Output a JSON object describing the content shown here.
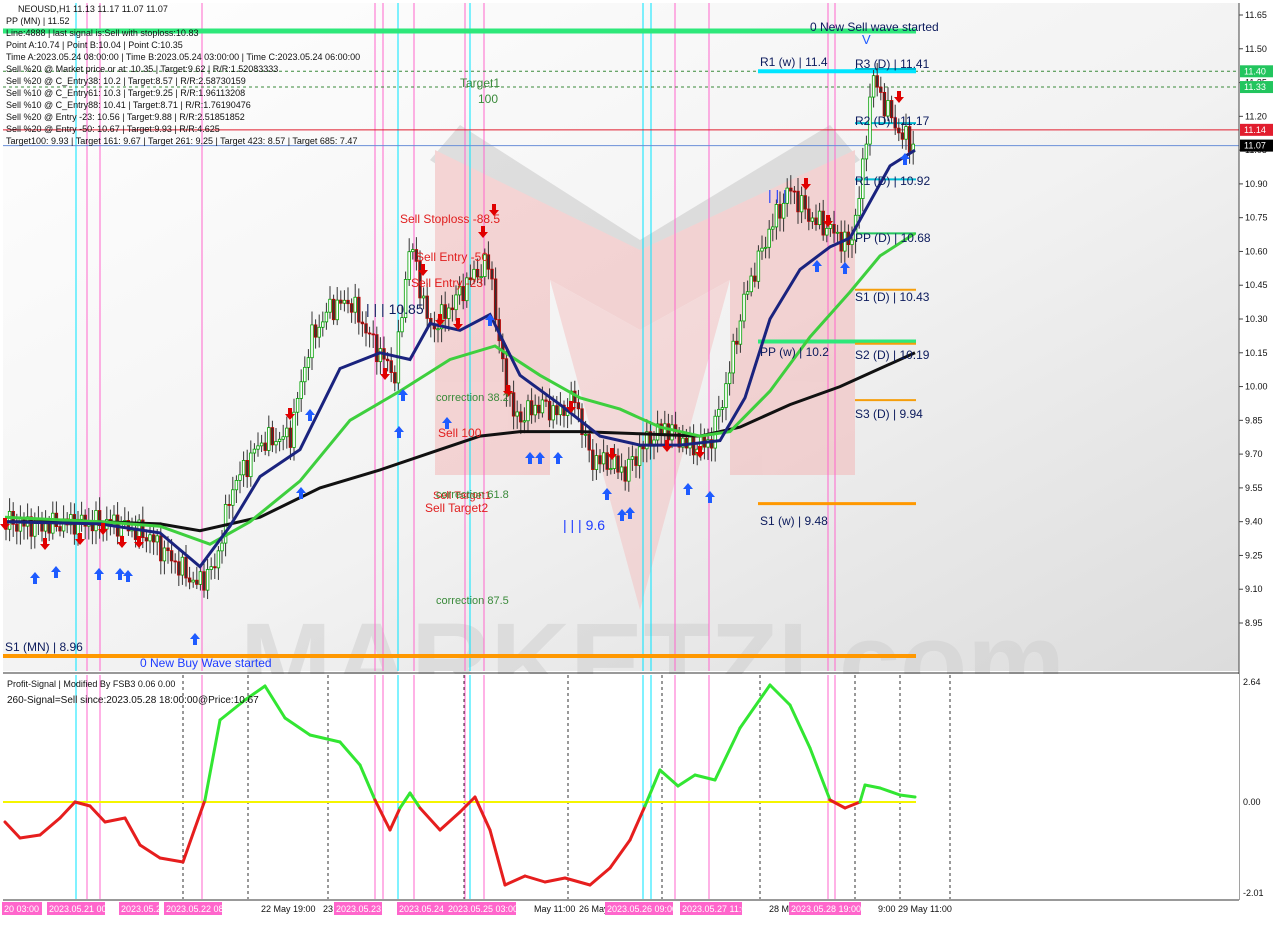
{
  "header": {
    "symbol_line": "NEOUSD,H1  11.13 11.17 11.07 11.07",
    "lines": [
      "PP (MN) | 11.52",
      "Line:4888 | last signal is:Sell with stoploss:10.83",
      "Point A:10.74 | Point B:10.04 | Point C:10.35",
      "Time A:2023.05.24 08:00:00 | Time B:2023.05.24 03:00:00 | Time C:2023.05.24 06:00:00",
      "Sell %20 @ Market price or at: 10.35 | Target:9.62 | R/R:1.52083333",
      "Sell %20 @ C_Entry38: 10.2 | Target:8.57 | R/R:2.58730159",
      "Sell %10 @ C_Entry61: 10.3 | Target:9.25 | R/R:1.96113208",
      "Sell %10 @ C_Entry88: 10.41 | Target:8.71 | R/R:1.76190476",
      "Sell %20 @ Entry -23: 10.56 | Target:9.88 | R/R:2.51851852",
      "Sell %20 @ Entry -50: 10.67 | Target:9.93 | R/R:4.625",
      "Target100: 9.93 | Target 161: 9.67 | Target 261: 9.25 | Target 423: 8.57 | Target 685: 7.47"
    ]
  },
  "price_axis": {
    "ticks": [
      "11.65",
      "11.50",
      "11.35",
      "11.20",
      "11.05",
      "10.90",
      "10.75",
      "10.60",
      "10.45",
      "10.30",
      "10.15",
      "10.00",
      "9.85",
      "9.70",
      "9.55",
      "9.40",
      "9.25",
      "9.10",
      "8.95"
    ],
    "badges": [
      {
        "label": "11.40",
        "color": "#22c55e"
      },
      {
        "label": "11.33",
        "color": "#22c55e"
      },
      {
        "label": "11.14",
        "color": "#e11d2e"
      },
      {
        "label": "11.07",
        "color": "#000000"
      }
    ]
  },
  "levels": [
    {
      "label": "R1 (w) | 11.4",
      "color": "#00bcd4"
    },
    {
      "label": "R3 (D) | 11.41",
      "color": "#00bcd4"
    },
    {
      "label": "R2 (D) | 11.17",
      "color": "#00bcd4"
    },
    {
      "label": "R1 (D) | 10.92",
      "color": "#00bcd4"
    },
    {
      "label": "PP (D) | 10.68",
      "color": "#22c55e"
    },
    {
      "label": "S1 (D) | 10.43",
      "color": "#f59e0b"
    },
    {
      "label": "PP (w) | 10.2",
      "color": "#22c55e"
    },
    {
      "label": "S2 (D) | 10.19",
      "color": "#f59e0b"
    },
    {
      "label": "S3 (D) | 9.94",
      "color": "#f59e0b"
    },
    {
      "label": "S1 (w) | 9.48",
      "color": "#f59e0b"
    },
    {
      "label": "S1 (MN) | 8.96",
      "color": "#f59e0b"
    }
  ],
  "annotations": {
    "sell_wave": "0 New Sell wave started",
    "buy_wave": "0 New Buy Wave started",
    "target1": "Target1",
    "target1_value": "100",
    "sell_stoploss": "Sell Stoploss -88.5",
    "sell_entry_50": "Sell Entry -50",
    "sell_entry_23": "Sell Entry -23",
    "sell_100": "Sell 100",
    "sell_target1": "Sell Target1",
    "sell_target2": "Sell Target2",
    "correction_38": "correction 38.2",
    "correction_61": "correction 61.8",
    "correction_87": "correction 87.5",
    "wave_high": "| | | 10.85",
    "wave_low": "| | | 9.6",
    "wave_mark": "| | |"
  },
  "indicator": {
    "name": "Profit-Signal | Modified By FSB3 0.06 0.00",
    "signal": "260-Signal=Sell since:2023.05.28 18:00:00@Price:10.67",
    "ticks": [
      "2.64",
      "0.00",
      "-2.01"
    ]
  },
  "time_axis": [
    {
      "label": "20 03:00",
      "highlight": true
    },
    {
      "label": "2023.05.21 00:00",
      "highlight": true
    },
    {
      "label": "2023.05.21 13:00",
      "highlight": true
    },
    {
      "label": "2023.05.22 08:00",
      "highlight": true
    },
    {
      "label": "22 May 19:00",
      "highlight": false
    },
    {
      "label": "23",
      "highlight": false
    },
    {
      "label": "2023.05.23 20:00",
      "highlight": true
    },
    {
      "label": "2023.05.24 10:00",
      "highlight": true
    },
    {
      "label": "2023.05.25 03:00",
      "highlight": true
    },
    {
      "label": "May 11:00",
      "highlight": false
    },
    {
      "label": "26 May",
      "highlight": false
    },
    {
      "label": "2023.05.26 09:00",
      "highlight": true
    },
    {
      "label": "2023.05.27 11:00",
      "highlight": true
    },
    {
      "label": "28 M",
      "highlight": false
    },
    {
      "label": "2023.05.28 19:00",
      "highlight": true
    },
    {
      "label": "9:00",
      "highlight": false
    },
    {
      "label": "29 May 11:00",
      "highlight": false
    }
  ],
  "watermark": "MARKETZI.com",
  "colors": {
    "bull": "#00a000",
    "bear": "#c00000",
    "ma_blue": "#1a237e",
    "ma_green": "#3ecf3e",
    "ma_black": "#111111",
    "buy_arrow": "#1e5bff",
    "sell_arrow": "#e00000",
    "osc_up": "#32e632",
    "osc_down": "#e61e1e",
    "zero_line": "#f5f500"
  }
}
